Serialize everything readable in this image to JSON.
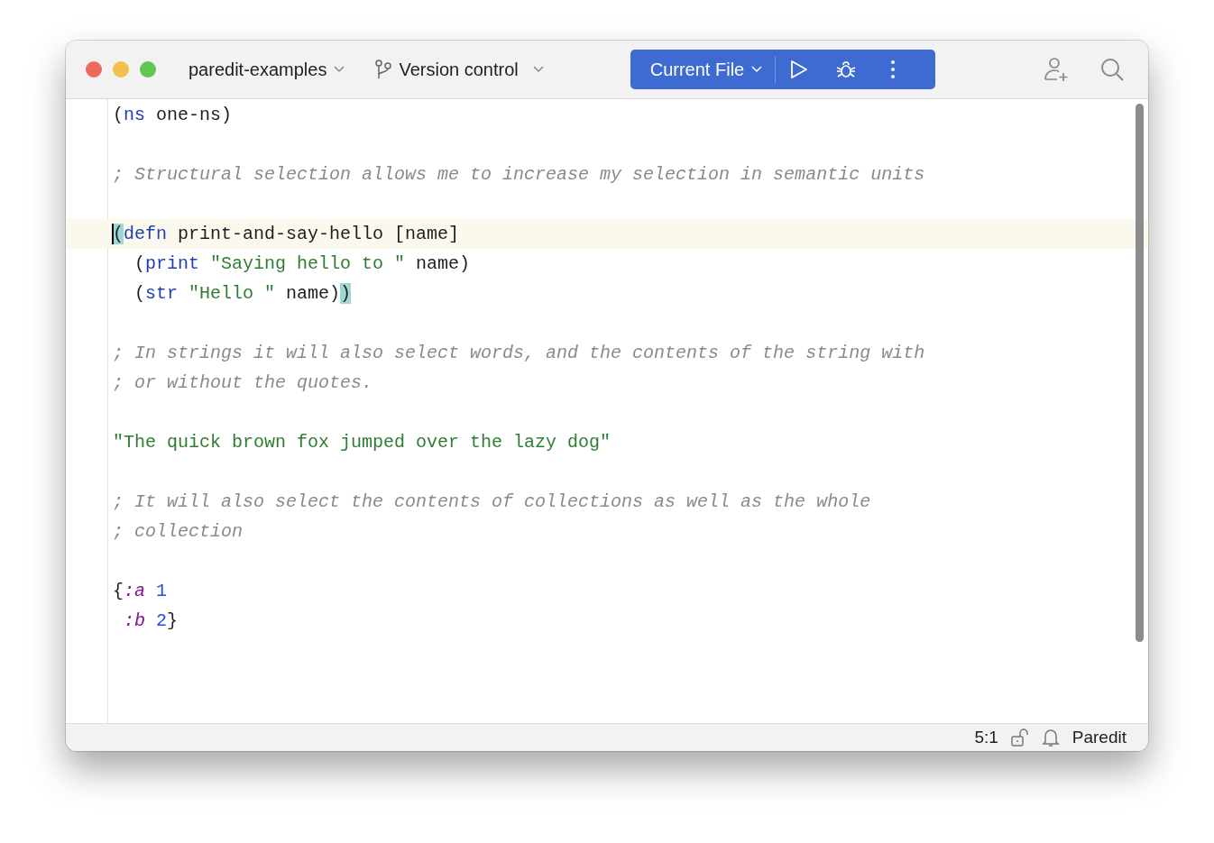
{
  "window": {
    "project": "paredit-examples",
    "vcs": "Version control",
    "run_config": "Current File"
  },
  "editor": {
    "lines": [
      {
        "current": false,
        "tokens": [
          {
            "text": "(",
            "kind": "plain"
          },
          {
            "text": "ns",
            "kind": "keyword"
          },
          {
            "text": " one-ns)",
            "kind": "plain"
          }
        ]
      },
      {
        "current": false
      },
      {
        "current": false,
        "tokens": [
          {
            "text": "; Structural selection allows me to increase my selection in semantic units",
            "kind": "comment"
          }
        ]
      },
      {
        "current": false
      },
      {
        "current": true,
        "caret": true,
        "tokens": [
          {
            "text": "(",
            "kind": "match"
          },
          {
            "text": "defn",
            "kind": "keyword"
          },
          {
            "text": " print-and-say-hello [name]",
            "kind": "plain"
          }
        ]
      },
      {
        "current": false,
        "tokens": [
          {
            "text": "  (",
            "kind": "plain"
          },
          {
            "text": "print",
            "kind": "keyword"
          },
          {
            "text": " \"Saying hello to \"",
            "kind": "string"
          },
          {
            "text": " name)",
            "kind": "plain"
          }
        ]
      },
      {
        "current": false,
        "tokens": [
          {
            "text": "  (",
            "kind": "plain"
          },
          {
            "text": "str",
            "kind": "keyword"
          },
          {
            "text": " \"Hello \"",
            "kind": "string"
          },
          {
            "text": " name)",
            "kind": "plain"
          },
          {
            "text": ")",
            "kind": "match"
          }
        ]
      },
      {
        "current": false
      },
      {
        "current": false,
        "tokens": [
          {
            "text": "; In strings it will also select words, and the contents of the string with",
            "kind": "comment"
          }
        ]
      },
      {
        "current": false,
        "tokens": [
          {
            "text": "; or without the quotes.",
            "kind": "comment"
          }
        ]
      },
      {
        "current": false
      },
      {
        "current": false,
        "tokens": [
          {
            "text": "\"The quick brown fox jumped over the lazy dog\"",
            "kind": "string"
          }
        ]
      },
      {
        "current": false
      },
      {
        "current": false,
        "tokens": [
          {
            "text": "; It will also select the contents of collections as well as the whole",
            "kind": "comment"
          }
        ]
      },
      {
        "current": false,
        "tokens": [
          {
            "text": "; collection",
            "kind": "comment"
          }
        ]
      },
      {
        "current": false
      },
      {
        "current": false,
        "tokens": [
          {
            "text": "{",
            "kind": "plain"
          },
          {
            "text": ":a",
            "kind": "symbol"
          },
          {
            "text": " 1",
            "kind": "number"
          }
        ]
      },
      {
        "current": false,
        "tokens": [
          {
            "text": " :b",
            "kind": "symbol"
          },
          {
            "text": " 2",
            "kind": "number"
          },
          {
            "text": "}",
            "kind": "plain"
          }
        ]
      }
    ]
  },
  "status_bar": {
    "position": "5:1",
    "mode": "Paredit"
  }
}
